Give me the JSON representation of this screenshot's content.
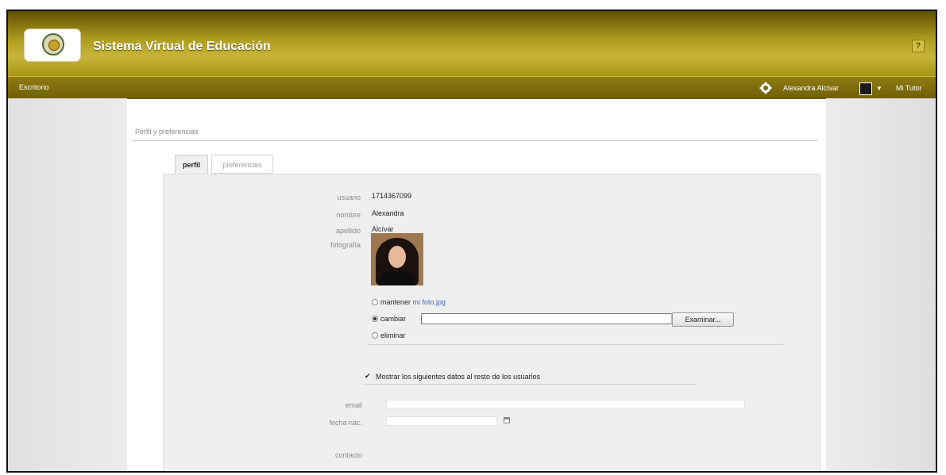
{
  "header": {
    "app_title": "Sistema Virtual de Educación",
    "help_label": "?"
  },
  "subbar": {
    "left_label": "Escritorio",
    "user_name": "Alexandra Alcívar",
    "caret": "▼",
    "my_tutor": "Mi Tutor"
  },
  "page": {
    "heading": "Perfil y preferencias"
  },
  "tabs": [
    {
      "label": "perfil",
      "active": true
    },
    {
      "label": "preferencias",
      "active": false
    }
  ],
  "profile": {
    "usuario_label": "usuario",
    "usuario_value": "1714367099",
    "nombre_label": "nombre",
    "nombre_value": "Alexandra",
    "apellido_label": "apellido",
    "apellido_value": "Alcívar",
    "fotografia_label": "fotografía"
  },
  "photo_options": {
    "keep_label": "mantener",
    "keep_file": "mi foto.jpg",
    "change_label": "cambiar",
    "browse_label": "Examinar...",
    "delete_label": "eliminar",
    "selected": "cambiar"
  },
  "visibility": {
    "show_label": "Mostrar los siguientes datos al resto de los usuarios",
    "checked": true,
    "check_glyph": "✔"
  },
  "fields": {
    "email_label": "email",
    "email_value": "",
    "birthdate_label": "fecha nac.",
    "birthdate_value": "",
    "contact_label": "contacto"
  },
  "colors": {
    "topbar": "#b19e20",
    "subbar": "#7e6c0c",
    "link": "#3a67b0"
  }
}
